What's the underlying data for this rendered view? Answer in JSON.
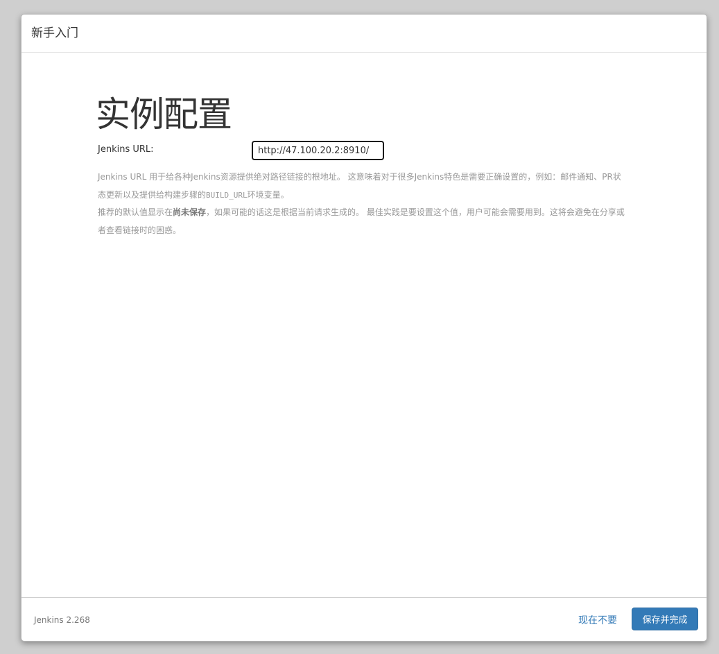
{
  "header": {
    "title": "新手入门"
  },
  "main": {
    "heading": "实例配置",
    "url_label": "Jenkins URL:",
    "url_value": "http://47.100.20.2:8910/",
    "help": {
      "p1_text": "Jenkins URL 用于给各种Jenkins资源提供绝对路径链接的根地址。 这意味着对于很多Jenkins特色是需要正确设置的，例如：邮件通知、PR状态更新以及提供给构建步骤的",
      "p1_code": "BUILD_URL",
      "p1_suffix": "环境变量。",
      "p2_prefix": "推荐的默认值显示在",
      "p2_strong": "尚未保存",
      "p2_suffix": "，如果可能的话这是根据当前请求生成的。 最佳实践是要设置这个值，用户可能会需要用到。这将会避免在分享或者查看链接时的困惑。"
    }
  },
  "footer": {
    "version": "Jenkins 2.268",
    "skip_label": "现在不要",
    "finish_label": "保存并完成"
  },
  "colors": {
    "primary": "#337ab7",
    "overlay": "#cfcfcf"
  }
}
